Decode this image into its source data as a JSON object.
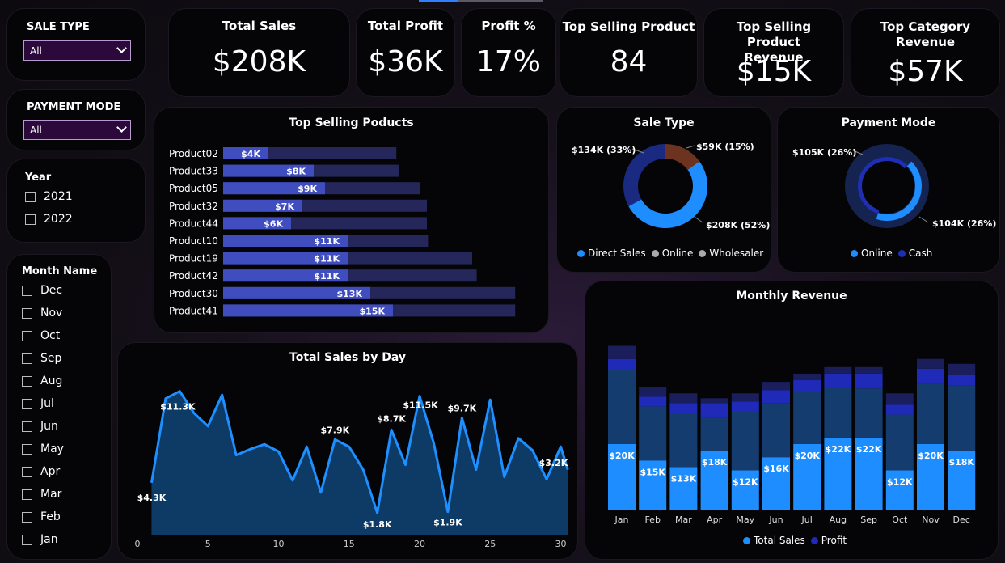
{
  "filters": {
    "sale_type": {
      "label": "SALE TYPE",
      "value": "All"
    },
    "payment_mode": {
      "label": "PAYMENT MODE",
      "value": "All"
    },
    "year": {
      "label": "Year",
      "options": [
        "2021",
        "2022"
      ]
    },
    "month": {
      "label": "Month Name",
      "options": [
        "Dec",
        "Nov",
        "Oct",
        "Sep",
        "Aug",
        "Jul",
        "Jun",
        "May",
        "Apr",
        "Mar",
        "Feb",
        "Jan"
      ]
    }
  },
  "kpis": [
    {
      "title": "Total Sales",
      "value": "$208K"
    },
    {
      "title": "Total Profit",
      "value": "$36K"
    },
    {
      "title": "Profit %",
      "value": "17%"
    },
    {
      "title": "Top Selling Product",
      "value": "84"
    },
    {
      "title": "Top Selling Product Revenue",
      "value": "$15K"
    },
    {
      "title": "Top Category Revenue",
      "value": "$57K"
    }
  ],
  "colors": {
    "bar": "#3f4dbf",
    "bar_bg": "#25275a",
    "line": "#1e8fff",
    "area": "#0e3a66",
    "total_sales": "#1d8dff",
    "profit_dark": "#143c6e",
    "profit": "#1f2ab8",
    "extra": "#1a1e5a",
    "direct": "#1d8dff",
    "online": "#1a2a80",
    "wholesaler": "#6b3320",
    "cash": "#1e2fb5",
    "online_pm": "#1d8dff"
  },
  "chart_data": [
    {
      "type": "bar",
      "orientation": "horizontal",
      "title": "Top Selling Poducts",
      "categories": [
        "Product02",
        "Product33",
        "Product05",
        "Product32",
        "Product44",
        "Product10",
        "Product19",
        "Product42",
        "Product30",
        "Product41"
      ],
      "values": [
        4,
        8,
        9,
        7,
        6,
        11,
        11,
        11,
        13,
        15
      ],
      "labels": [
        "$4K",
        "$8K",
        "$9K",
        "$7K",
        "$6K",
        "$11K",
        "$11K",
        "$11K",
        "$13K",
        "$15K"
      ],
      "background_values": [
        15.3,
        15.5,
        17.4,
        18.0,
        18.0,
        18.1,
        22.0,
        22.4,
        25.8,
        25.8
      ]
    },
    {
      "type": "pie",
      "variant": "donut",
      "title": "Sale Type",
      "slices": [
        {
          "name": "Direct Sales",
          "value": 52,
          "label": "$208K (52%)"
        },
        {
          "name": "Online",
          "value": 33,
          "label": "$134K (33%)"
        },
        {
          "name": "Wholesaler",
          "value": 15,
          "label": "$59K (15%)"
        }
      ]
    },
    {
      "type": "pie",
      "variant": "donut",
      "title": "Payment Mode",
      "slices": [
        {
          "name": "Online",
          "value": 26,
          "label": "$104K (26%)"
        },
        {
          "name": "Cash",
          "value": 26,
          "label": "$105K (26%)"
        }
      ]
    },
    {
      "type": "area",
      "title": "Total Sales by Day",
      "x": [
        1,
        2,
        3,
        4,
        5,
        6,
        7,
        8,
        9,
        10,
        11,
        12,
        13,
        14,
        15,
        16,
        17,
        18,
        19,
        20,
        21,
        22,
        23,
        24,
        25,
        26,
        27,
        28,
        29,
        30
      ],
      "y": [
        4.3,
        11.3,
        11.9,
        10.1,
        9.0,
        11.6,
        6.6,
        7.1,
        7.5,
        6.9,
        4.5,
        7.3,
        3.5,
        7.9,
        7.3,
        5.4,
        1.8,
        8.7,
        5.8,
        11.5,
        7.6,
        1.9,
        9.7,
        5.4,
        11.2,
        4.8,
        8.0,
        7.0,
        4.6,
        7.3
      ],
      "data_labels": [
        {
          "x": 1,
          "text": "$4.3K"
        },
        {
          "x": 2,
          "text": "$11.3K"
        },
        {
          "x": 14,
          "text": "$7.9K"
        },
        {
          "x": 17,
          "text": "$1.8K"
        },
        {
          "x": 18,
          "text": "$8.7K"
        },
        {
          "x": 20,
          "text": "$11.5K"
        },
        {
          "x": 22,
          "text": "$1.9K"
        },
        {
          "x": 23,
          "text": "$9.7K"
        },
        {
          "x": 30,
          "text": "$3.2K"
        }
      ],
      "x_ticks": [
        0,
        5,
        10,
        15,
        20,
        25,
        30
      ],
      "xlim": [
        0,
        30
      ],
      "ylim": [
        0,
        13
      ]
    },
    {
      "type": "bar",
      "stacked": true,
      "title": "Monthly Revenue",
      "categories": [
        "Jan",
        "Feb",
        "Mar",
        "Apr",
        "May",
        "Jun",
        "Jul",
        "Aug",
        "Sep",
        "Oct",
        "Nov",
        "Dec"
      ],
      "series": [
        {
          "name": "Total Sales",
          "values": [
            20,
            15,
            13,
            18,
            12,
            16,
            20,
            22,
            22,
            12,
            20,
            18
          ],
          "labels": [
            "$20K",
            "$15K",
            "$13K",
            "$18K",
            "$12K",
            "$16K",
            "$20K",
            "$22K",
            "$22K",
            "$12K",
            "$20K",
            "$18K"
          ]
        },
        {
          "values": [
            22.5,
            16.5,
            16.5,
            10.0,
            18.0,
            16.5,
            16.0,
            15.5,
            15.0,
            17.0,
            18.5,
            20.0
          ]
        },
        {
          "name": "Profit",
          "values": [
            3.5,
            3.0,
            3.0,
            4.5,
            3.0,
            4.0,
            3.5,
            4.0,
            4.5,
            3.0,
            4.5,
            3.0
          ]
        },
        {
          "values": [
            4.0,
            3.0,
            3.0,
            1.5,
            2.5,
            2.5,
            2.0,
            2.0,
            2.0,
            3.5,
            3.0,
            3.5
          ]
        }
      ],
      "ylim": [
        0,
        55
      ]
    }
  ]
}
